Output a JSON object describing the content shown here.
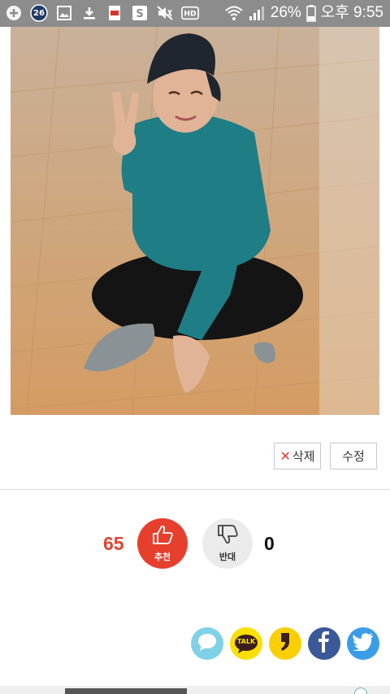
{
  "status_bar": {
    "notification_count": "26",
    "battery": "26%",
    "time": "오후 9:55"
  },
  "photo": {
    "alt": ""
  },
  "actions": {
    "delete_label": "삭제",
    "modify_label": "수정"
  },
  "vote": {
    "up_count": "65",
    "up_label": "추천",
    "down_count": "0",
    "down_label": "반대"
  },
  "share": {
    "talk_label": "TALK"
  },
  "colors": {
    "accent": "#e63f2e",
    "status_bar": "#8c8c8c"
  }
}
